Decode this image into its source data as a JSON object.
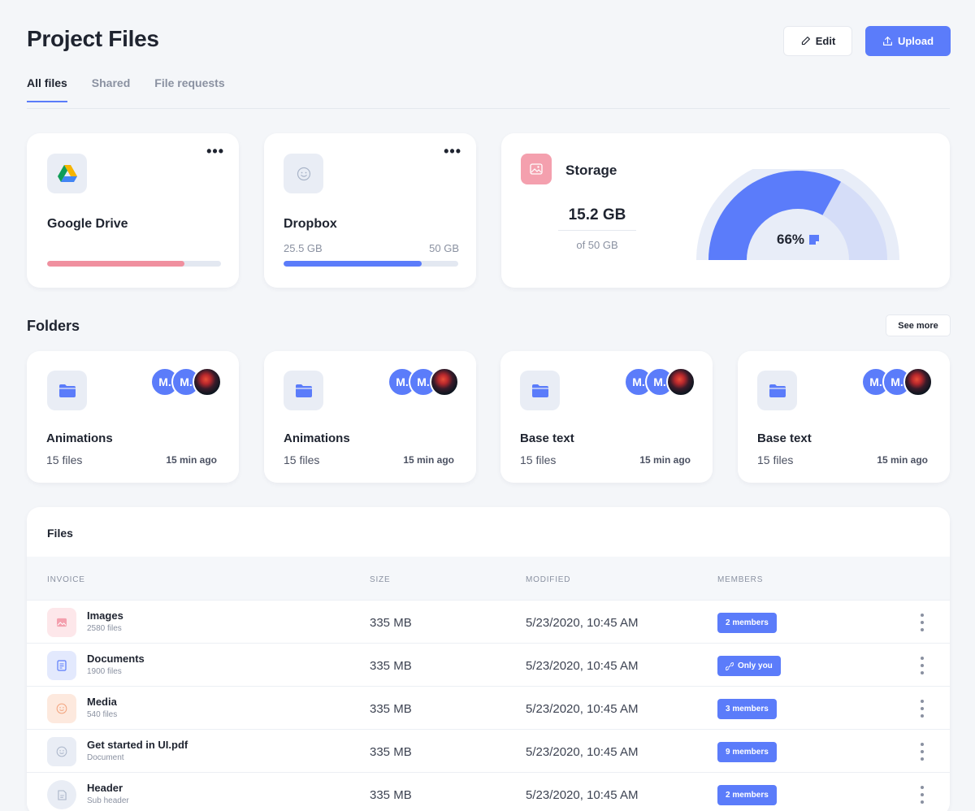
{
  "header": {
    "title": "Project Files",
    "edit_label": "Edit",
    "upload_label": "Upload"
  },
  "tabs": [
    {
      "label": "All files"
    },
    {
      "label": "Shared"
    },
    {
      "label": "File requests"
    }
  ],
  "cloud": [
    {
      "name": "Google Drive",
      "used_fraction": 0.79,
      "used": "",
      "total": "",
      "color": "#f0909f"
    },
    {
      "name": "Dropbox",
      "used_fraction": 0.79,
      "used": "25.5 GB",
      "total": "50 GB",
      "color": "#5b7cfa"
    }
  ],
  "storage": {
    "title": "Storage",
    "amount": "15.2 GB",
    "of": "of 50 GB",
    "percent_label": "66%",
    "percent": 66,
    "accent": "#5b7cfa"
  },
  "folders": {
    "title": "Folders",
    "see_more": "See more",
    "items": [
      {
        "name": "Animations",
        "count": "15 files",
        "time": "15 min ago",
        "avatars": [
          "M.",
          "M."
        ]
      },
      {
        "name": "Animations",
        "count": "15 files",
        "time": "15 min ago",
        "avatars": [
          "M.",
          "M."
        ]
      },
      {
        "name": "Base text",
        "count": "15 files",
        "time": "15 min ago",
        "avatars": [
          "M.",
          "M."
        ]
      },
      {
        "name": "Base text",
        "count": "15 files",
        "time": "15 min ago",
        "avatars": [
          "M.",
          "M."
        ]
      }
    ]
  },
  "files": {
    "title": "Files",
    "columns": {
      "invoice": "INVOICE",
      "size": "SIZE",
      "modified": "MODIFIED",
      "members": "MEMBERS"
    },
    "rows": [
      {
        "name": "Images",
        "sub": "2580 files",
        "size": "335 MB",
        "modified": "5/23/2020, 10:45 AM",
        "members": "2 members",
        "icon": "image-icon"
      },
      {
        "name": "Documents",
        "sub": "1900 files",
        "size": "335 MB",
        "modified": "5/23/2020, 10:45 AM",
        "members": "Only you",
        "icon": "document-icon"
      },
      {
        "name": "Media",
        "sub": "540 files",
        "size": "335 MB",
        "modified": "5/23/2020, 10:45 AM",
        "members": "3 members",
        "icon": "smiley-icon"
      },
      {
        "name": "Get started in UI.pdf",
        "sub": "Document",
        "size": "335 MB",
        "modified": "5/23/2020, 10:45 AM",
        "members": "9 members",
        "icon": "smiley-icon"
      },
      {
        "name": "Header",
        "sub": "Sub header",
        "size": "335 MB",
        "modified": "5/23/2020, 10:45 AM",
        "members": "2 members",
        "icon": "file-icon"
      }
    ]
  }
}
